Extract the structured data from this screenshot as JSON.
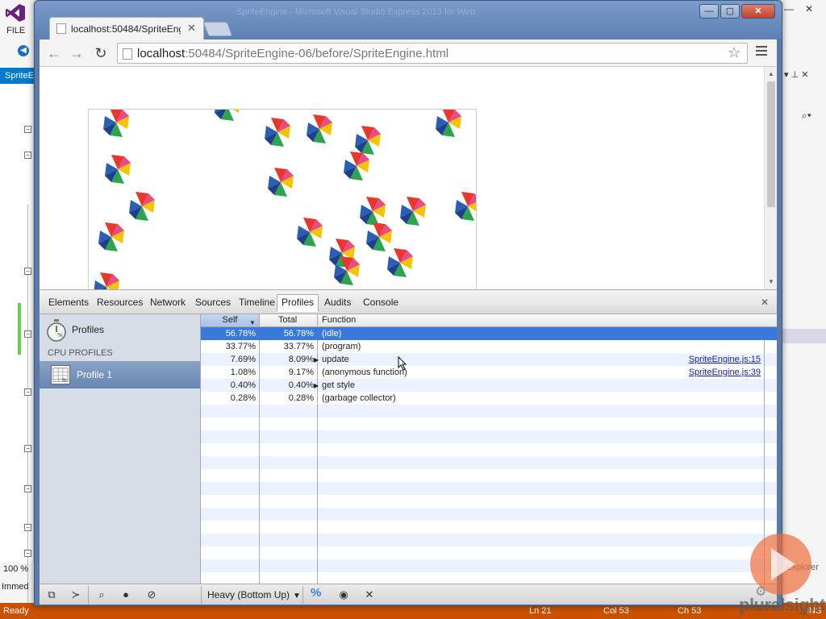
{
  "vs": {
    "menu_file": "FILE",
    "tab_label": "SpriteE",
    "zoom": "100 %",
    "immediate": "Immed",
    "status": {
      "ready": "Ready",
      "ln": "Ln 21",
      "col": "Col 53",
      "ch": "Ch 53",
      "ins": "INS"
    },
    "explorer": "Explorer",
    "title_ghost": "SpriteEngine - Microsoft Visual Studio Express 2013 for Web"
  },
  "browser": {
    "tab_title": "localhost:50484/SpriteEng",
    "url_host": "localhost",
    "url_rest": ":50484/SpriteEngine-06/before/SpriteEngine.html"
  },
  "devtools": {
    "tabs": [
      {
        "label": "Elements"
      },
      {
        "label": "Resources"
      },
      {
        "label": "Network"
      },
      {
        "label": "Sources"
      },
      {
        "label": "Timeline"
      },
      {
        "label": "Profiles"
      },
      {
        "label": "Audits"
      },
      {
        "label": "Console"
      }
    ],
    "active_tab": "Profiles",
    "sidebar": {
      "title": "Profiles",
      "section": "CPU PROFILES",
      "profile": "Profile 1"
    },
    "columns": {
      "self": "Self",
      "total": "Total",
      "function": "Function"
    },
    "rows": [
      {
        "self": "56.78%",
        "total": "56.78%",
        "fn": "(idle)",
        "expandable": false,
        "link": "",
        "selected": true
      },
      {
        "self": "33.77%",
        "total": "33.77%",
        "fn": "(program)",
        "expandable": false,
        "link": "",
        "selected": false
      },
      {
        "self": "7.69%",
        "total": "8.09%",
        "fn": "update",
        "expandable": true,
        "link": "SpriteEngine.js:15",
        "selected": false
      },
      {
        "self": "1.08%",
        "total": "9.17%",
        "fn": "(anonymous function)",
        "expandable": false,
        "link": "SpriteEngine.js:39",
        "selected": false
      },
      {
        "self": "0.40%",
        "total": "0.40%",
        "fn": "get style",
        "expandable": true,
        "link": "",
        "selected": false
      },
      {
        "self": "0.28%",
        "total": "0.28%",
        "fn": "(garbage collector)",
        "expandable": false,
        "link": "",
        "selected": false
      }
    ],
    "status_bar": {
      "view_mode": "Heavy (Bottom Up)",
      "percent_toggle": "%"
    }
  },
  "watermark": {
    "brand": "pluralsight"
  },
  "colors": {
    "selection": "#3879d9",
    "vs_status": "#ca5100",
    "link": "#1a1aa6"
  }
}
